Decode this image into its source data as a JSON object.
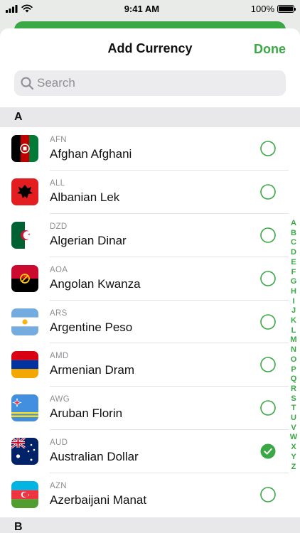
{
  "status": {
    "time": "9:41 AM",
    "battery": "100%"
  },
  "header": {
    "title": "Add Currency",
    "done_label": "Done"
  },
  "search": {
    "placeholder": "Search"
  },
  "sections": [
    {
      "letter": "A"
    },
    {
      "letter": "B"
    }
  ],
  "currencies": [
    {
      "code": "AFN",
      "name": "Afghan Afghani",
      "selected": false
    },
    {
      "code": "ALL",
      "name": "Albanian Lek",
      "selected": false
    },
    {
      "code": "DZD",
      "name": "Algerian Dinar",
      "selected": false
    },
    {
      "code": "AOA",
      "name": "Angolan Kwanza",
      "selected": false
    },
    {
      "code": "ARS",
      "name": "Argentine Peso",
      "selected": false
    },
    {
      "code": "AMD",
      "name": "Armenian Dram",
      "selected": false
    },
    {
      "code": "AWG",
      "name": "Aruban Florin",
      "selected": false
    },
    {
      "code": "AUD",
      "name": "Australian Dollar",
      "selected": true
    },
    {
      "code": "AZN",
      "name": "Azerbaijani Manat",
      "selected": false
    }
  ],
  "index_letters": [
    "A",
    "B",
    "C",
    "D",
    "E",
    "F",
    "G",
    "H",
    "I",
    "J",
    "K",
    "L",
    "M",
    "N",
    "O",
    "P",
    "Q",
    "R",
    "S",
    "T",
    "U",
    "V",
    "W",
    "X",
    "Y",
    "Z"
  ],
  "colors": {
    "accent": "#3aa845",
    "divider": "#e3e3e6",
    "section_bg": "#e8e8ea"
  }
}
